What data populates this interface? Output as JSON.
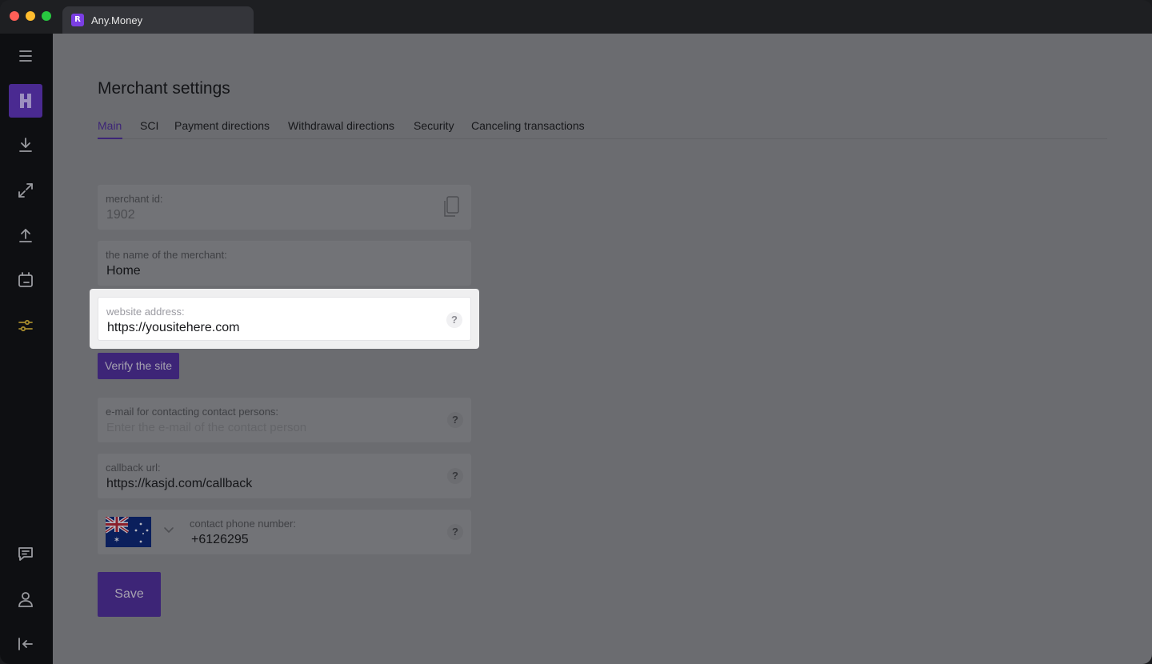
{
  "window": {
    "tab_title": "Any.Money",
    "tab_logo": "R"
  },
  "colors": {
    "accent": "#4a2a91",
    "active_tab": "#3d2577",
    "sidebar_bg": "#0e0f12"
  },
  "sidebar": {
    "items": [
      {
        "icon": "menu-icon"
      },
      {
        "icon": "brand-icon"
      },
      {
        "icon": "download-icon"
      },
      {
        "icon": "exchange-icon"
      },
      {
        "icon": "upload-icon"
      },
      {
        "icon": "wallet-icon"
      },
      {
        "icon": "settings-sliders-icon"
      },
      {
        "icon": "chat-icon"
      },
      {
        "icon": "user-icon"
      },
      {
        "icon": "logout-icon"
      }
    ]
  },
  "page": {
    "title": "Merchant settings"
  },
  "tabs": [
    {
      "label": "Main",
      "active": true
    },
    {
      "label": "SCI"
    },
    {
      "label": "Payment directions"
    },
    {
      "label": "Withdrawal directions"
    },
    {
      "label": "Security"
    },
    {
      "label": "Canceling transactions"
    }
  ],
  "form": {
    "merchant_id": {
      "label": "merchant id:",
      "value": "1902"
    },
    "merchant_name": {
      "label": "the name of the merchant:",
      "value": "Home"
    },
    "website": {
      "label": "website address:",
      "value": "https://yousitehere.com",
      "help": "?"
    },
    "verify_label": "Verify the site",
    "email": {
      "label": "e-mail for contacting contact persons:",
      "placeholder": "Enter the e-mail of the contact person",
      "help": "?"
    },
    "callback": {
      "label": "callback url:",
      "value": "https://kasjd.com/callback",
      "help": "?"
    },
    "phone": {
      "label": "contact phone number:",
      "value": "+6126295",
      "help": "?",
      "country_flag": "australia-flag-icon"
    },
    "save_label": "Save"
  }
}
